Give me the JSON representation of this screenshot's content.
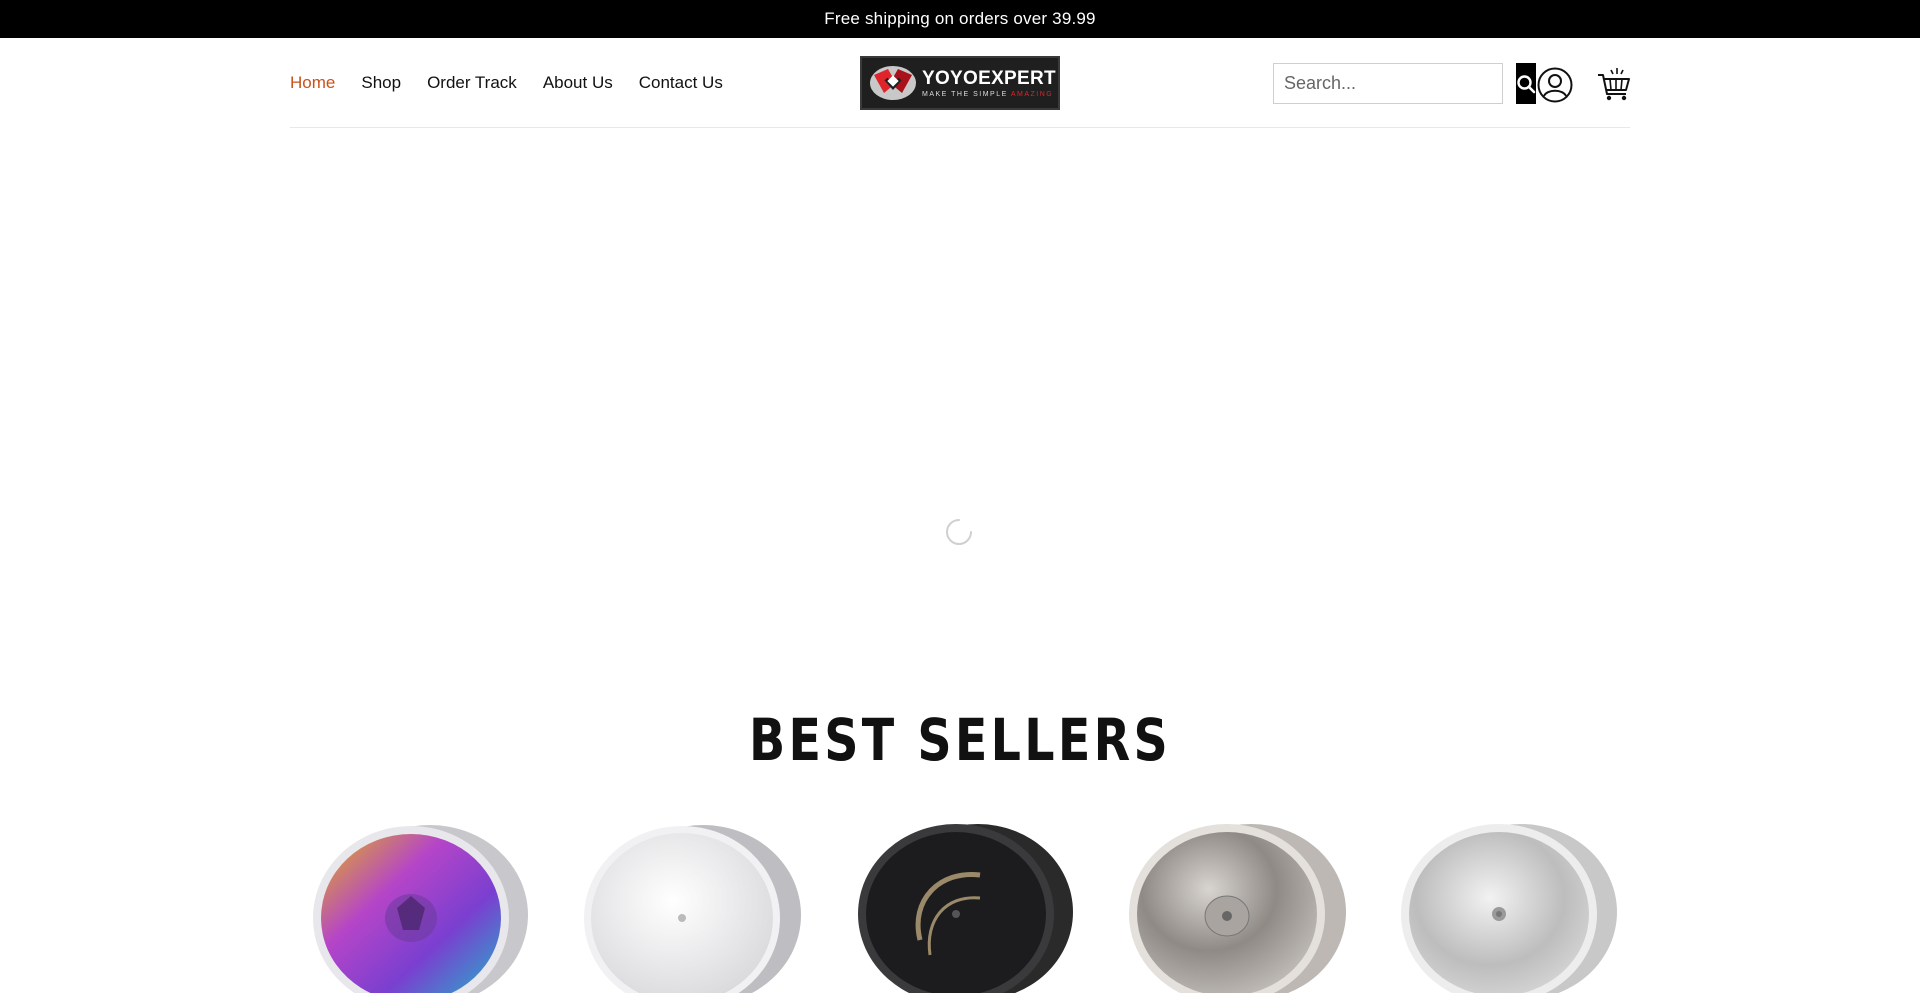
{
  "announcement": "Free shipping on orders over 39.99",
  "nav": {
    "items": [
      {
        "label": "Home",
        "active": true
      },
      {
        "label": "Shop",
        "active": false
      },
      {
        "label": "Order Track",
        "active": false
      },
      {
        "label": "About Us",
        "active": false
      },
      {
        "label": "Contact Us",
        "active": false
      }
    ]
  },
  "logo": {
    "name": "YOYOEXPERT",
    "tagline_prefix": "MAKE THE SIMPLE ",
    "tagline_accent": "AMAZING"
  },
  "search": {
    "placeholder": "Search...",
    "icon": "search-icon"
  },
  "header_icons": {
    "account": "user-icon",
    "cart": "cart-icon"
  },
  "hero": {
    "state": "loading",
    "icon": "loading-spinner-icon"
  },
  "best_sellers": {
    "title": "BEST SELLERS",
    "products": [
      {
        "image": "rainbow-yoyo"
      },
      {
        "image": "white-silver-yoyo"
      },
      {
        "image": "black-yoyo"
      },
      {
        "image": "silver-yoyo"
      },
      {
        "image": "silver-yoyo-2"
      }
    ]
  },
  "colors": {
    "accent": "#c9521a",
    "announcement_bg": "#000000",
    "logo_red": "#e0242c"
  }
}
